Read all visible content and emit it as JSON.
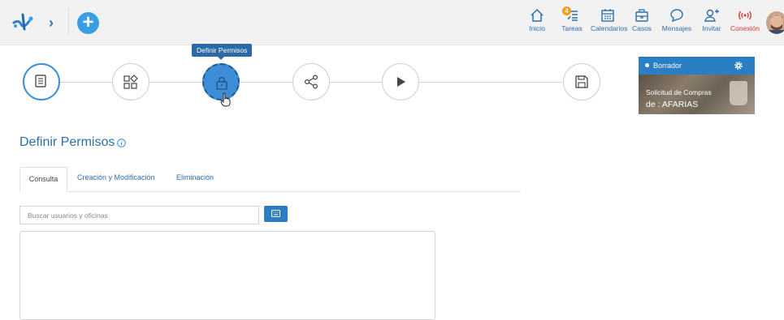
{
  "header": {
    "nav": [
      {
        "key": "inicio",
        "label": "Inicio",
        "icon": "home-icon"
      },
      {
        "key": "tareas",
        "label": "Tareas",
        "icon": "tasks-icon",
        "badge": "4"
      },
      {
        "key": "calendarios",
        "label": "Calendarios",
        "icon": "calendar-icon"
      },
      {
        "key": "casos",
        "label": "Casos",
        "icon": "briefcase-icon"
      },
      {
        "key": "mensajes",
        "label": "Mensajes",
        "icon": "chat-bubble-icon"
      },
      {
        "key": "invitar",
        "label": "Invitar",
        "icon": "add-user-icon"
      },
      {
        "key": "conexion",
        "label": "Conexión",
        "icon": "wireless-icon"
      }
    ],
    "brand_color": "#3a9ee4",
    "connection_color": "#d03a2f"
  },
  "stepper": {
    "tooltip": "Definir Permisos",
    "steps": [
      {
        "name": "form-step",
        "icon": "form-icon"
      },
      {
        "name": "shapes-step",
        "icon": "shapes-icon"
      },
      {
        "name": "permissions-step",
        "icon": "lock-icon",
        "active": true
      },
      {
        "name": "share-step",
        "icon": "share-icon"
      },
      {
        "name": "play-step",
        "icon": "play-icon"
      },
      {
        "name": "save-step",
        "icon": "save-icon"
      }
    ],
    "active_color": "#3d8ed6"
  },
  "status_card": {
    "status": "Borrador",
    "line1": "Solicitud de Compras",
    "line2": "de : AFARIAS"
  },
  "main": {
    "title": "Definir Permisos",
    "tabs": [
      {
        "label": "Consulta",
        "active": true
      },
      {
        "label": "Creación y Modificación",
        "active": false
      },
      {
        "label": "Eliminación",
        "active": false
      }
    ],
    "search_placeholder": "Buscar usuarios y oficinas"
  }
}
